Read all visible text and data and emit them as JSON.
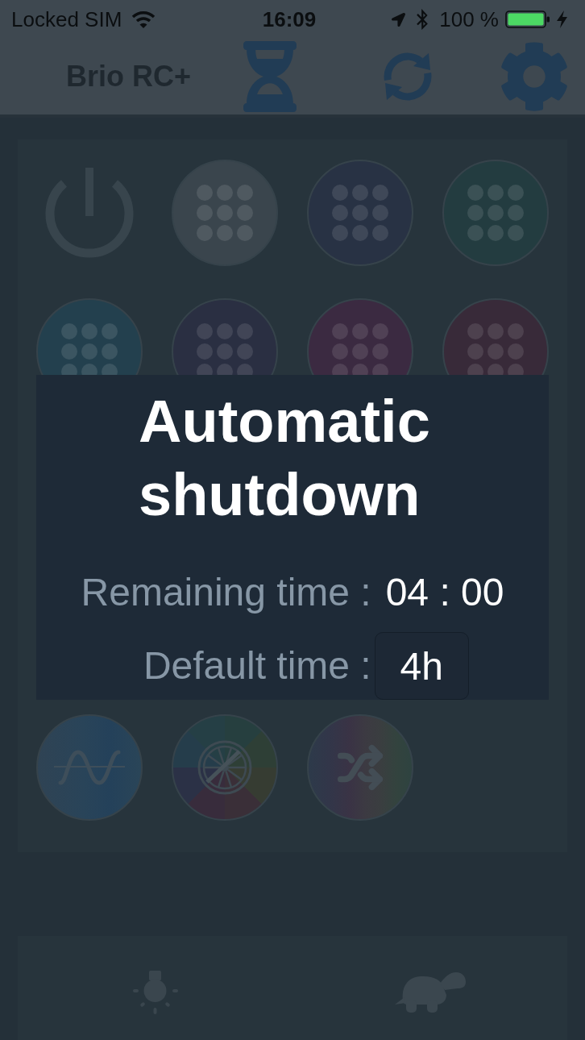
{
  "status_bar": {
    "carrier": "Locked SIM",
    "time": "16:09",
    "battery": "100 %"
  },
  "header": {
    "title": "Brio RC+"
  },
  "grid": {
    "rows": [
      [
        {
          "kind": "power"
        },
        {
          "kind": "color",
          "color": "#3a454d"
        },
        {
          "kind": "color",
          "color": "#283244"
        },
        {
          "kind": "color",
          "color": "#233c40"
        }
      ],
      [
        {
          "kind": "color",
          "color": "#23404e"
        },
        {
          "kind": "color",
          "color": "#2a2f42"
        },
        {
          "kind": "color",
          "color": "#3b2a41"
        },
        {
          "kind": "color",
          "color": "#382a39"
        }
      ],
      [
        {
          "kind": "wave"
        },
        {
          "kind": "wheel"
        },
        {
          "kind": "shuffle"
        }
      ]
    ]
  },
  "dialog": {
    "title": "Automatic shutdown",
    "rows": [
      {
        "kind": "text",
        "label": "Remaining time :",
        "value": "04 : 00"
      },
      {
        "kind": "picker",
        "label": "Default time :",
        "value": "4h"
      }
    ]
  }
}
